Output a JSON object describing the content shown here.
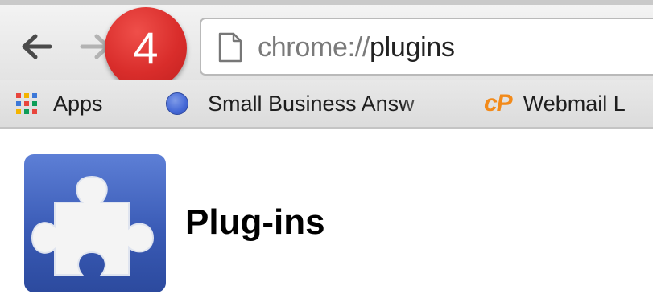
{
  "toolbar": {
    "url_scheme": "chrome://",
    "url_path": "plugins"
  },
  "step_badge": {
    "number": "4",
    "color": "#d92d2b"
  },
  "bookmarks": [
    {
      "label": "Apps",
      "icon": "apps-grid-icon"
    },
    {
      "label": "Small Business Answ",
      "icon": "blue-circle-icon"
    },
    {
      "label": "Webmail L",
      "icon": "cpanel-logo-icon",
      "logo_text": "cP"
    }
  ],
  "page": {
    "title": "Plug-ins",
    "icon": "puzzle-piece-icon"
  },
  "colors": {
    "accent_orange": "#f28a1a",
    "logo_blue": "#3a5bb6"
  }
}
